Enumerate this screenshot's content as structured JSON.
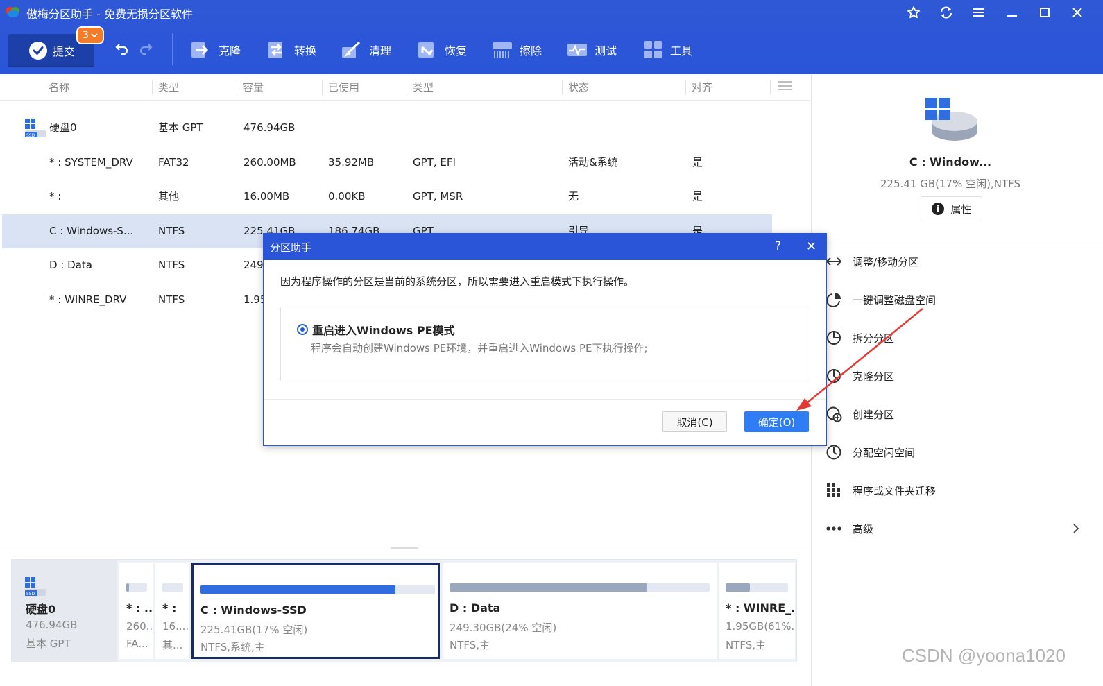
{
  "window": {
    "title": "傲梅分区助手 - 免费无损分区软件"
  },
  "toolbar": {
    "commit_label": "提交",
    "pending_count": "3",
    "tools": [
      "克隆",
      "转换",
      "清理",
      "恢复",
      "擦除",
      "测试",
      "工具"
    ]
  },
  "table": {
    "columns": [
      "名称",
      "类型",
      "容量",
      "已使用",
      "类型",
      "状态",
      "对齐"
    ],
    "disk": {
      "name": "硬盘0",
      "type": "基本 GPT",
      "capacity": "476.94GB"
    },
    "partitions": [
      {
        "name": "* : SYSTEM_DRV",
        "type": "FAT32",
        "capacity": "260.00MB",
        "used": "35.92MB",
        "ptype": "GPT, EFI",
        "status": "活动&系统",
        "align": "是"
      },
      {
        "name": "* :",
        "type": "其他",
        "capacity": "16.00MB",
        "used": "0.00KB",
        "ptype": "GPT, MSR",
        "status": "无",
        "align": "是"
      },
      {
        "name": "C : Windows-S...",
        "type": "NTFS",
        "capacity": "225.41GB",
        "used": "186.74GB",
        "ptype": "GPT",
        "status": "引导",
        "align": "是"
      },
      {
        "name": "D : Data",
        "type": "NTFS",
        "capacity": "249",
        "used": "",
        "ptype": "",
        "status": "",
        "align": ""
      },
      {
        "name": "* : WINRE_DRV",
        "type": "NTFS",
        "capacity": "1.95",
        "used": "",
        "ptype": "",
        "status": "",
        "align": ""
      }
    ]
  },
  "right_panel": {
    "title": "C : Window...",
    "subtitle": "225.41 GB(17% 空闲),NTFS",
    "properties_label": "属性",
    "operations": [
      "调整/移动分区",
      "一键调整磁盘空间",
      "拆分分区",
      "克隆分区",
      "创建分区",
      "分配空闲空间",
      "程序或文件夹迁移",
      "高级"
    ]
  },
  "disk_map": {
    "disk": {
      "name": "硬盘0",
      "size": "476.94GB",
      "type": "基本 GPT"
    },
    "partitions": [
      {
        "name": "* : ...",
        "size": "260...",
        "fs": "FA...",
        "used_fraction": 0.14
      },
      {
        "name": "* :",
        "size": "16....",
        "fs": "其...",
        "used_fraction": 0.0
      },
      {
        "name": "C : Windows-SSD",
        "size": "225.41GB(17% 空闲)",
        "fs": "NTFS,系统,主",
        "used_fraction": 0.83
      },
      {
        "name": "D : Data",
        "size": "249.30GB(24% 空闲)",
        "fs": "NTFS,主",
        "used_fraction": 0.76
      },
      {
        "name": "* : WINRE_...",
        "size": "1.95GB(61%...",
        "fs": "NTFS,主",
        "used_fraction": 0.39
      }
    ]
  },
  "dialog": {
    "title": "分区助手",
    "help": "?",
    "close": "✕",
    "message": "因为程序操作的分区是当前的系统分区，所以需要进入重启模式下执行操作。",
    "option_title": "重启进入Windows PE模式",
    "option_desc": "程序会自动创建Windows PE环境，并重启进入Windows PE下执行操作;",
    "cancel_label": "取消(C)",
    "ok_label": "确定(O)"
  },
  "watermark": "CSDN @yoona1020",
  "colors": {
    "toolbar_bg": "#2a55d8",
    "selected_row": "#d9e3f3",
    "primary_button": "#2f7df5",
    "annotation_arrow": "#e53935"
  }
}
